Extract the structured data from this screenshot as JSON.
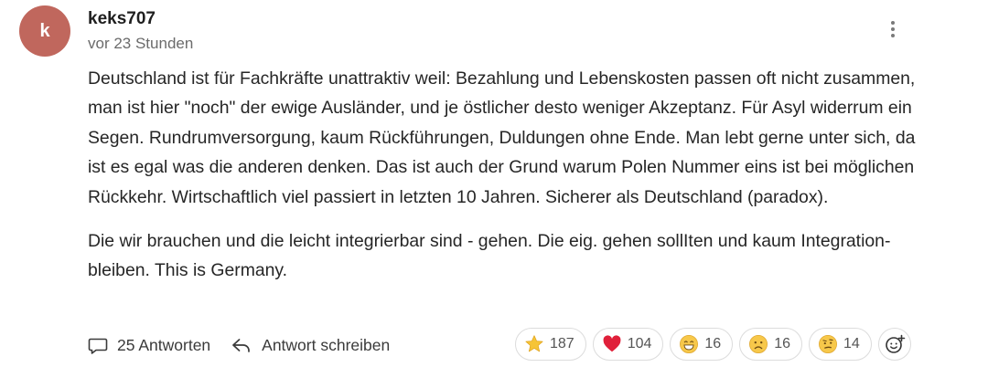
{
  "comment": {
    "avatar_letter": "k",
    "author": "keks707",
    "timestamp": "vor 23 Stunden",
    "paragraphs": [
      "Deutschland ist für Fachkräfte unattraktiv weil: Bezahlung und Lebenskosten passen oft nicht zusammen, man ist hier \"noch\" der ewige Ausländer, und je östlicher desto weniger Akzeptanz. Für Asyl widerrum ein Segen. Rundrumversorgung, kaum Rückführungen, Duldungen ohne Ende. Man lebt gerne unter sich, da ist es egal was die anderen denken. Das ist auch der Grund warum Polen Nummer eins ist bei möglichen Rückkehr. Wirtschaftlich viel passiert in letzten 10 Jahren. Sicherer als Deutschland (paradox).",
      "Die wir brauchen und die leicht integrierbar sind - gehen. Die eig. gehen sollIten und kaum Integration- bleiben. This is Germany."
    ]
  },
  "actions": {
    "replies_label": "25 Antworten",
    "reply_label": "Antwort schreiben"
  },
  "reactions": [
    {
      "icon": "star-emoji-icon",
      "count": "187"
    },
    {
      "icon": "heart-emoji-icon",
      "count": "104"
    },
    {
      "icon": "grinning-emoji-icon",
      "count": "16"
    },
    {
      "icon": "sad-emoji-icon",
      "count": "16"
    },
    {
      "icon": "skeptical-emoji-icon",
      "count": "14"
    }
  ],
  "colors": {
    "avatar": "#c0675d",
    "star": "#f6c436",
    "heart": "#e0203a",
    "emoji_face": "#f7c84a"
  }
}
